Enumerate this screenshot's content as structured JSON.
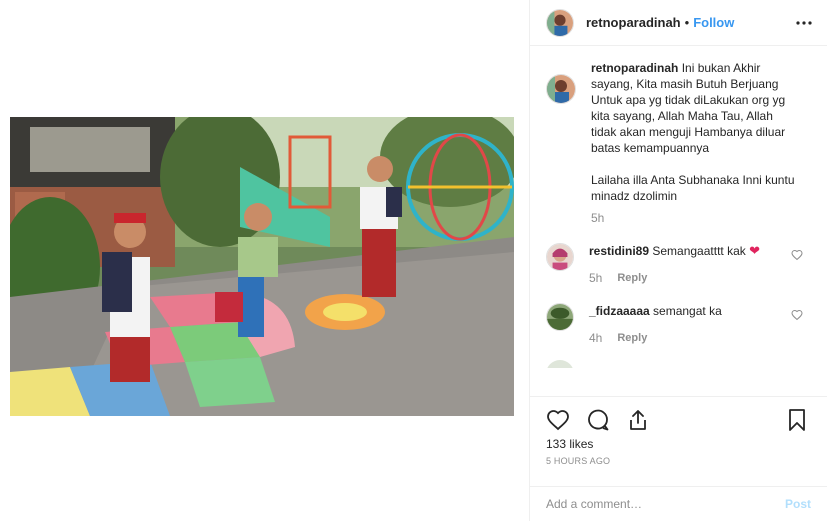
{
  "post": {
    "username": "retnoparadinah",
    "follow_label": "Follow",
    "separator": "•",
    "more_icon": "more-horizontal-icon",
    "image_alt": "Children in school uniforms playing hopscotch in a schoolyard"
  },
  "caption": {
    "username": "retnoparadinah",
    "text": " Ini bukan Akhir sayang, Kita masih Butuh Berjuang Untuk apa yg tidak diLakukan org yg kita sayang, Allah Maha Tau, Allah tidak akan menguji Hambanya diluar batas kemampuannya\n\nLailaha illa Anta Subhanaka Inni kuntu minadz dzolimin",
    "time": "5h"
  },
  "comments": [
    {
      "username": "restidini89",
      "text": " Semangaatttt kak ",
      "emoji": "❤",
      "time": "5h",
      "reply_label": "Reply"
    },
    {
      "username": "_fidzaaaaa",
      "text": " semangat ka",
      "time": "4h",
      "reply_label": "Reply"
    }
  ],
  "actions": {
    "likes": "133 likes",
    "date": "5 HOURS AGO"
  },
  "add_comment": {
    "placeholder": "Add a comment…",
    "post_label": "Post"
  },
  "colors": {
    "link_blue": "#3897f0",
    "post_disabled": "#b2dffc",
    "muted": "#8e8e8e",
    "text": "#262626",
    "divider": "#efefef"
  }
}
